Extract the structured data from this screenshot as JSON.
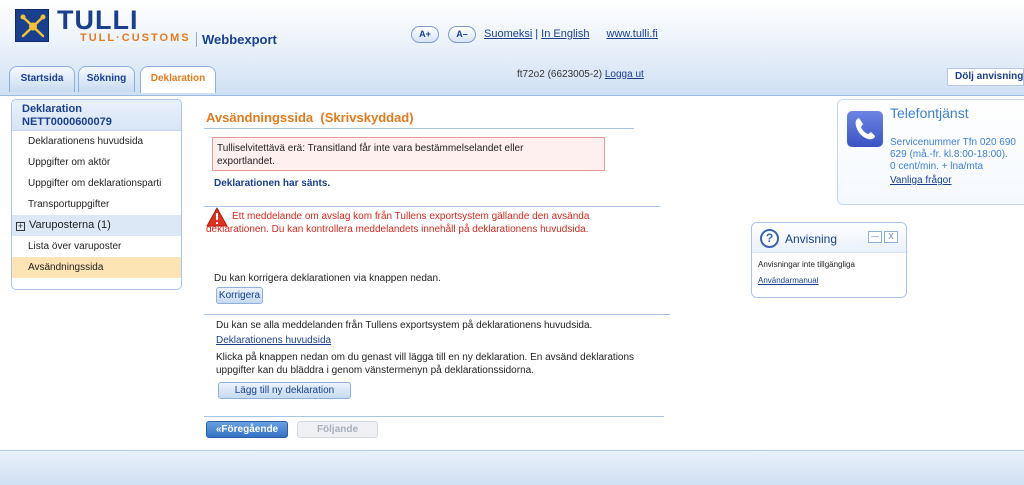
{
  "header": {
    "brand": "TULLI",
    "brand_sub": "TULL·CUSTOMS",
    "product": "Webbexport",
    "font_increase": "A+",
    "font_decrease": "A–",
    "lang_fi": "Suomeksi",
    "lang_en": "In English",
    "site_link": "www.tulli.fi",
    "sep": "|"
  },
  "tabs": [
    {
      "label": "Startsida"
    },
    {
      "label": "Sökning"
    },
    {
      "label": "Deklaration"
    }
  ],
  "user": {
    "id": "ft72o2 (6623005-2)",
    "logout": "Logga ut"
  },
  "hide_guidance": "Dölj anvisning",
  "sidebar": {
    "title": "Deklaration",
    "number": "NETT0000600079",
    "items": [
      {
        "label": "Deklarationens huvudsida"
      },
      {
        "label": "Uppgifter om aktör"
      },
      {
        "label": "Uppgifter om deklarationsparti"
      },
      {
        "label": "Transportuppgifter"
      },
      {
        "label": "Varuposterna (1)"
      },
      {
        "label": "Lista över varuposter"
      },
      {
        "label": "Avsändningssida"
      }
    ]
  },
  "main": {
    "title": "Avsändningssida  (Skrivskyddad)",
    "error_line1": "Tulliselvitettävä erä: Transitland får inte vara bestämmelselandet eller",
    "error_line2": "exportlandet.",
    "sent_status": "Deklarationen har sänts.",
    "rejection_notice": "Ett meddelande om avslag kom från Tullens exportsystem gällande den avsända deklarationen. Du kan kontrollera meddelandets innehåll på deklarationens huvudsida.",
    "correct_text": "Du kan korrigera deklarationen via knappen nedan.",
    "correct_button": "Korrigera",
    "messages_text": "Du kan se alla meddelanden från Tullens exportsystem på deklarationens huvudsida.",
    "main_page_link": "Deklarationens huvudsida",
    "new_decl_text": "Klicka på knappen nedan om du genast vill lägga till en ny deklaration. En avsänd deklarations uppgifter kan du bläddra i genom vänstermenyn på deklarationssidorna.",
    "new_decl_button": "Lägg till ny deklaration",
    "prev_button": "«Föregående",
    "next_button": "Följande"
  },
  "phone_service": {
    "title": "Telefontjänst",
    "line1": "Servicenummer Tfn 020 690",
    "line2": "629 (må.-fr. kl.8:00-18:00).",
    "line3": "0 cent/min. + lna/mta",
    "faq_link": "Vanliga frågor"
  },
  "guidance": {
    "title": "Anvisning",
    "minimize": "—",
    "close": "X",
    "text": "Anvisningar inte tillgängliga",
    "manual_link": "Användarmanual"
  },
  "colors": {
    "brand_blue": "#1a3f8f",
    "accent_orange": "#e37b1e",
    "error_red": "#d42a1e"
  }
}
